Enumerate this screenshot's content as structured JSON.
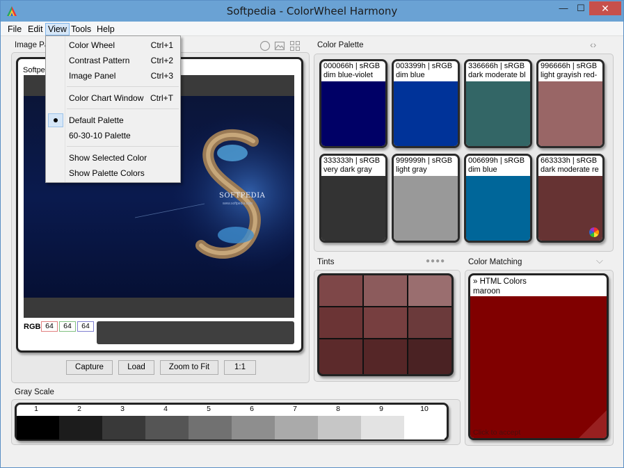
{
  "window": {
    "title": "Softpedia - ColorWheel Harmony",
    "controls": {
      "minimize": "—",
      "maximize": "☐",
      "close": "✕"
    }
  },
  "menubar": {
    "items": [
      "File",
      "Edit",
      "View",
      "Tools",
      "Help"
    ],
    "active": "View"
  },
  "view_menu": {
    "items": [
      {
        "label": "Color Wheel",
        "shortcut": "Ctrl+1"
      },
      {
        "label": "Contrast Pattern",
        "shortcut": "Ctrl+2"
      },
      {
        "label": "Image Panel",
        "shortcut": "Ctrl+3"
      },
      {
        "label": "Color Chart Window",
        "shortcut": "Ctrl+T"
      },
      {
        "label": "Default Palette",
        "shortcut": "",
        "checked": true
      },
      {
        "label": "60-30-10 Palette",
        "shortcut": ""
      },
      {
        "label": "Show Selected Color",
        "shortcut": ""
      },
      {
        "label": "Show Palette Colors",
        "shortcut": ""
      }
    ]
  },
  "image_panel": {
    "label": "Image Pa",
    "card_label": "Softpe",
    "image_text": "SOFTPEDIA",
    "image_subtext": "www.softpedia.com",
    "rgb_label": "RGB",
    "rgb_values": [
      "64",
      "64",
      "64"
    ],
    "buttons": {
      "capture": "Capture",
      "load": "Load",
      "zoom": "Zoom to Fit",
      "one_to_one": "1:1"
    }
  },
  "color_palette": {
    "label": "Color Palette",
    "swatches": [
      {
        "line1": "000066h | sRGB",
        "line2": "dim blue-violet",
        "color": "#000066"
      },
      {
        "line1": "003399h | sRGB",
        "line2": "dim blue",
        "color": "#003399"
      },
      {
        "line1": "336666h | sRGB",
        "line2": "dark moderate bl",
        "color": "#336666"
      },
      {
        "line1": "996666h | sRGB",
        "line2": "light grayish red-",
        "color": "#996666"
      },
      {
        "line1": "333333h | sRGB",
        "line2": "very dark gray",
        "color": "#333333"
      },
      {
        "line1": "999999h | sRGB",
        "line2": "light gray",
        "color": "#999999"
      },
      {
        "line1": "006699h | sRGB",
        "line2": "dim blue",
        "color": "#006699"
      },
      {
        "line1": "663333h | sRGB",
        "line2": "dark moderate re",
        "color": "#663333"
      }
    ]
  },
  "tints": {
    "label": "Tints",
    "colors": [
      "#7e4748",
      "#8c5b5c",
      "#9a6e6f",
      "#6b3435",
      "#773f40",
      "#6b3a3b",
      "#5c2a2b",
      "#552627",
      "#4a2223"
    ]
  },
  "color_matching": {
    "label": "Color Matching",
    "line1": "» HTML Colors",
    "line2": "maroon",
    "color": "#800000",
    "footer": "Click to accept"
  },
  "gray_scale": {
    "label": "Gray Scale",
    "numbers": [
      "1",
      "2",
      "3",
      "4",
      "5",
      "6",
      "7",
      "8",
      "9",
      "10"
    ],
    "colors": [
      "#000000",
      "#1c1c1c",
      "#393939",
      "#555555",
      "#717171",
      "#8e8e8e",
      "#aaaaaa",
      "#c6c6c6",
      "#e3e3e3",
      "#ffffff"
    ]
  }
}
